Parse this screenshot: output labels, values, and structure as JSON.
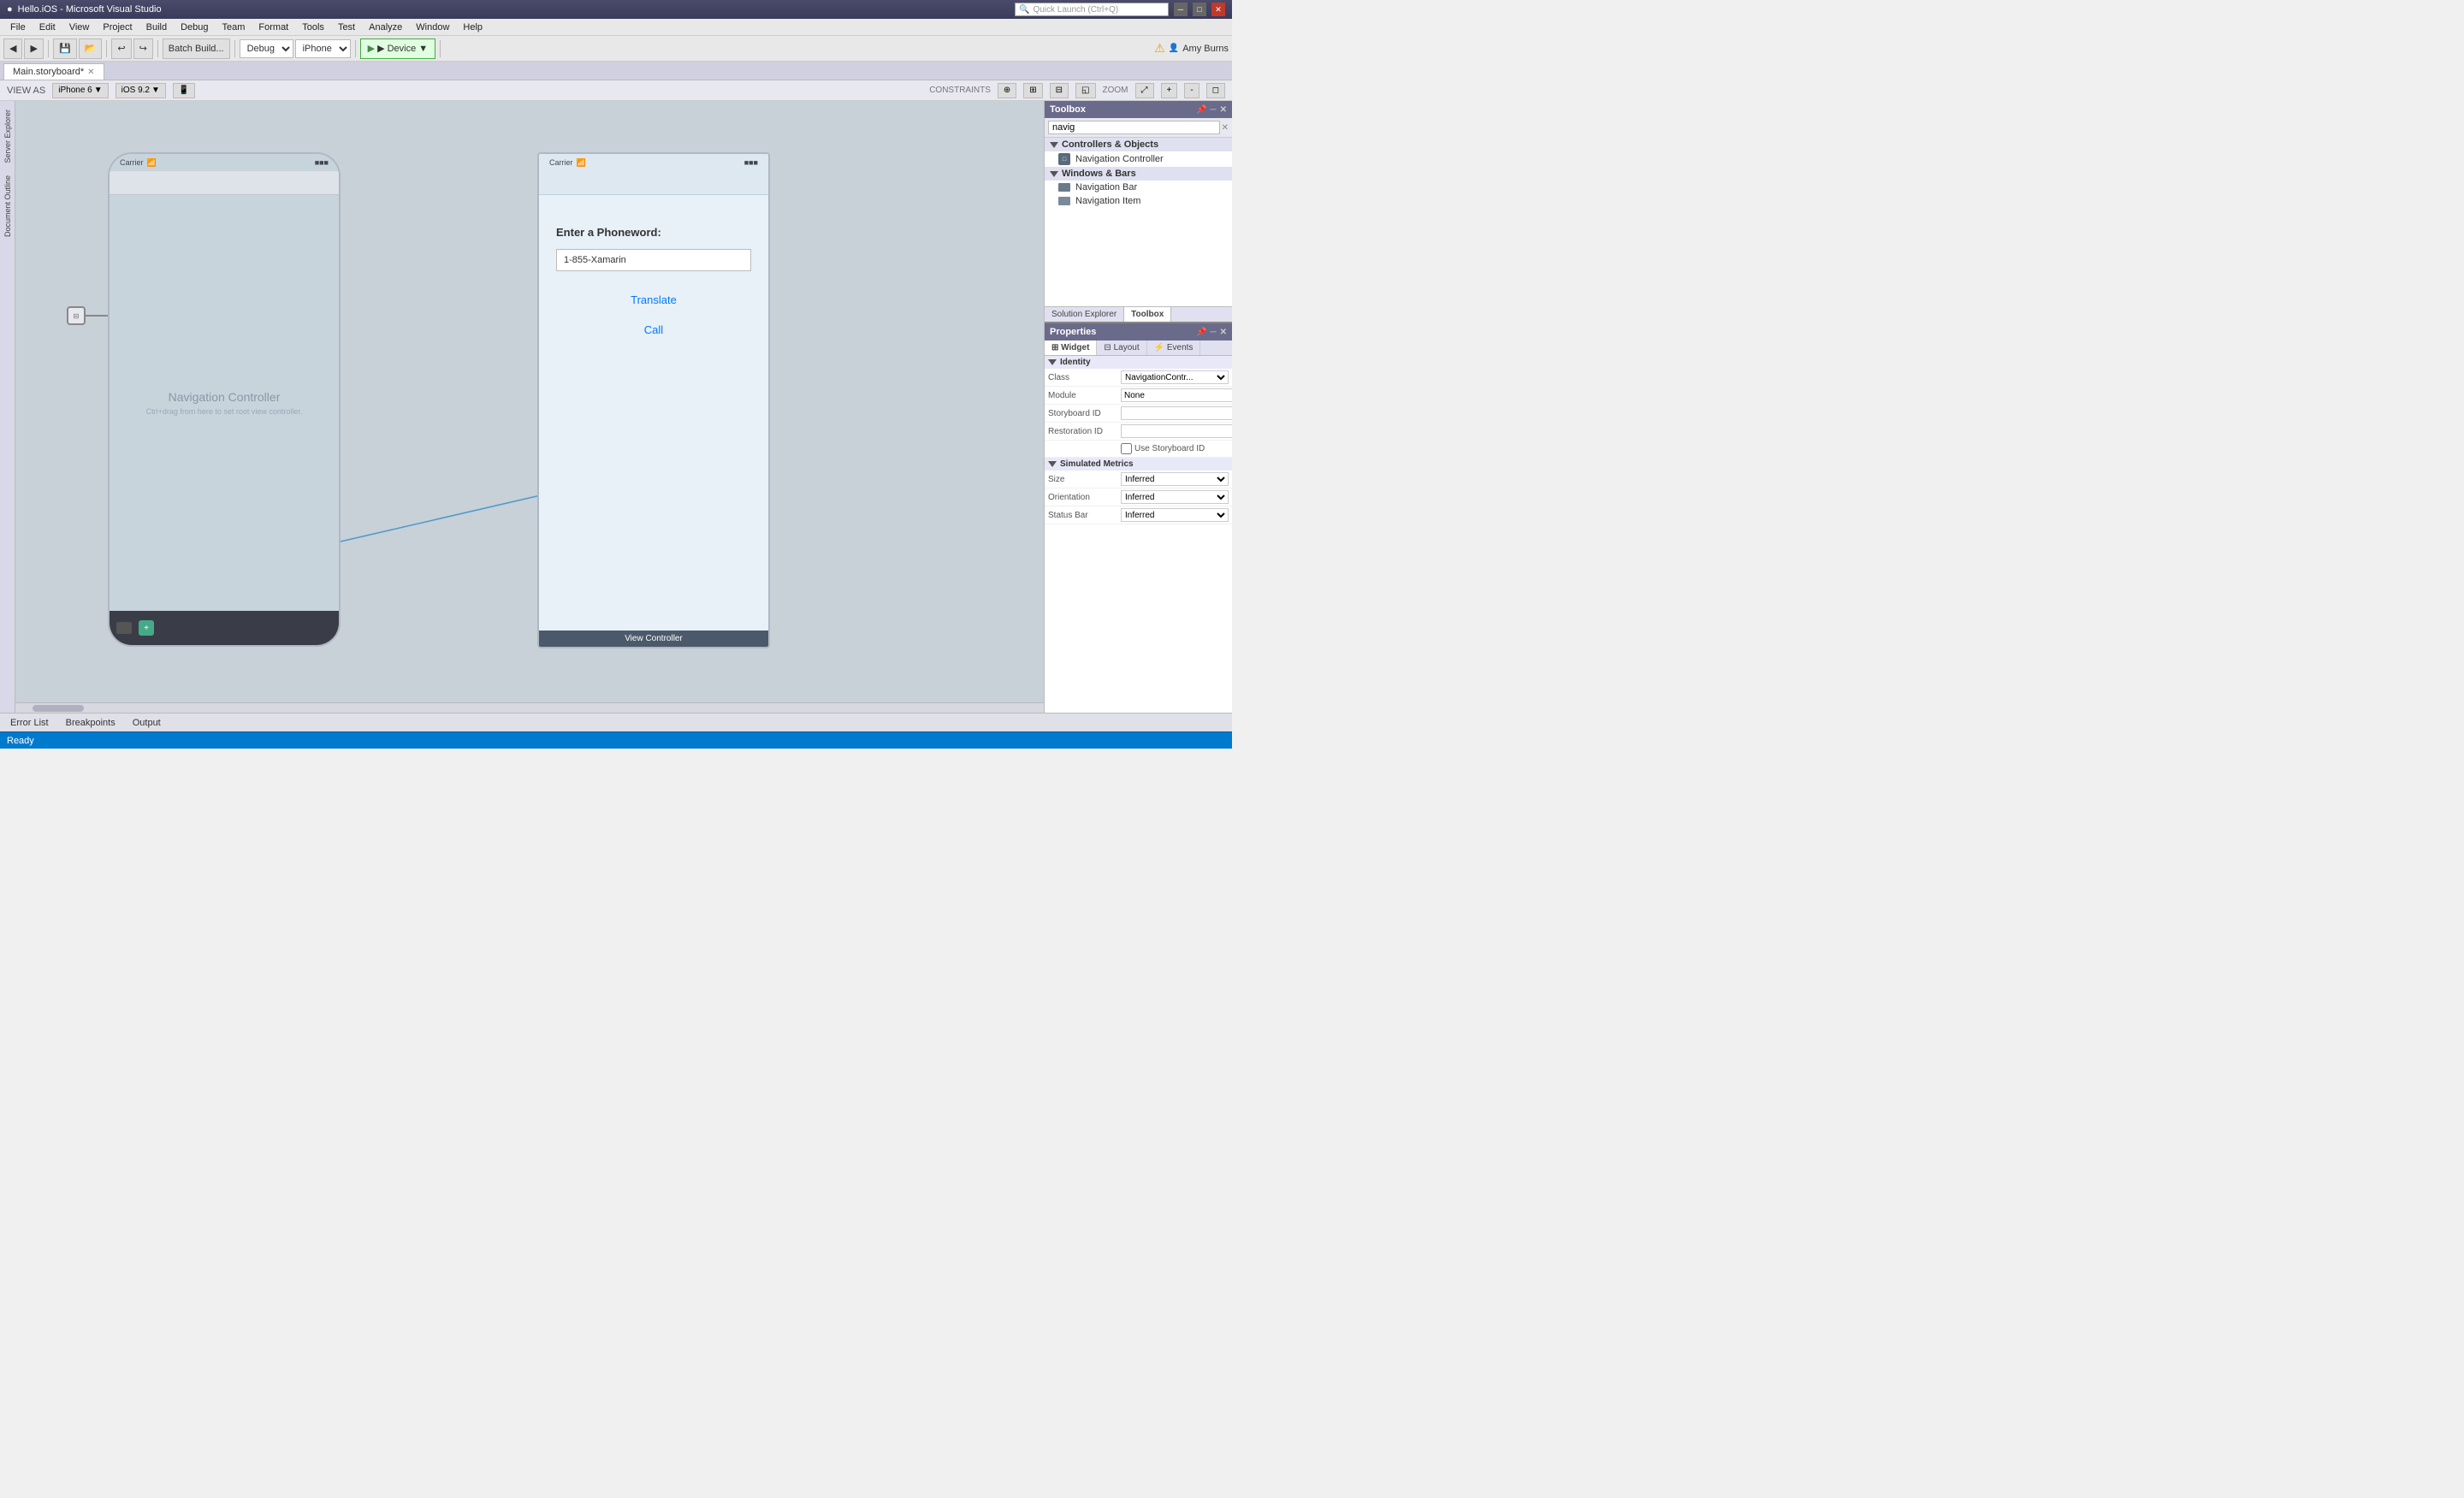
{
  "titlebar": {
    "icon": "●",
    "title": "Hello.iOS - Microsoft Visual Studio",
    "search_placeholder": "Quick Launch (Ctrl+Q)"
  },
  "menubar": {
    "items": [
      "File",
      "Edit",
      "View",
      "Project",
      "Build",
      "Debug",
      "Team",
      "Format",
      "Tools",
      "Test",
      "Analyze",
      "Window",
      "Help"
    ]
  },
  "toolbar": {
    "batch_build": "Batch Build...",
    "config": "Debug",
    "device": "iPhone",
    "play_label": "▶ Device",
    "user": "Amy Burns"
  },
  "tabs": {
    "main": "Main.storyboard*",
    "close": "✕"
  },
  "view_options": {
    "view_as_label": "VIEW AS",
    "iphone_label": "iPhone 6",
    "ios_label": "iOS 9.2",
    "constraints_label": "CONSTRAINTS",
    "zoom_label": "ZOOM"
  },
  "canvas": {
    "navigation_controller": {
      "status_carrier": "Carrier",
      "status_battery": "■■■",
      "title": "Navigation Controller",
      "hint": "Ctrl+drag from here to set root view controller."
    },
    "view_controller": {
      "status_carrier": "Carrier",
      "status_battery": "■■■",
      "label": "Enter a Phoneword:",
      "input_value": "1-855-Xamarin",
      "translate_btn": "Translate",
      "call_btn": "Call",
      "bar_label": "View Controller"
    }
  },
  "toolbox": {
    "title": "Toolbox",
    "search_value": "navig",
    "clear_btn": "✕",
    "sections": [
      {
        "name": "Controllers & Objects",
        "items": [
          {
            "label": "Navigation Controller",
            "icon": "nav-controller-icon"
          }
        ]
      },
      {
        "name": "Windows & Bars",
        "items": [
          {
            "label": "Navigation Bar",
            "icon": "nav-bar-icon"
          },
          {
            "label": "Navigation Item",
            "icon": "nav-item-icon"
          }
        ]
      }
    ]
  },
  "solution_tab": "Solution Explorer",
  "toolbox_tab": "Toolbox",
  "properties": {
    "title": "Properties",
    "tabs": [
      "Widget",
      "Layout",
      "Events"
    ],
    "active_tab": "Widget",
    "sections": [
      {
        "name": "Identity",
        "rows": [
          {
            "label": "Class",
            "value": "NavigationContr...",
            "type": "dropdown"
          },
          {
            "label": "Module",
            "value": "None",
            "type": "text"
          },
          {
            "label": "Storyboard ID",
            "value": "",
            "type": "text"
          },
          {
            "label": "Restoration ID",
            "value": "",
            "type": "text"
          },
          {
            "label": "Use Storyboard ID",
            "value": false,
            "type": "checkbox"
          }
        ]
      },
      {
        "name": "Simulated Metrics",
        "rows": [
          {
            "label": "Size",
            "value": "Inferred",
            "type": "dropdown"
          },
          {
            "label": "Orientation",
            "value": "Inferred",
            "type": "dropdown"
          },
          {
            "label": "Status Bar",
            "value": "Inferred",
            "type": "dropdown"
          }
        ]
      }
    ]
  },
  "statusbar": {
    "text": "Ready"
  },
  "bottom_tabs": [
    "Error List",
    "Breakpoints",
    "Output"
  ]
}
